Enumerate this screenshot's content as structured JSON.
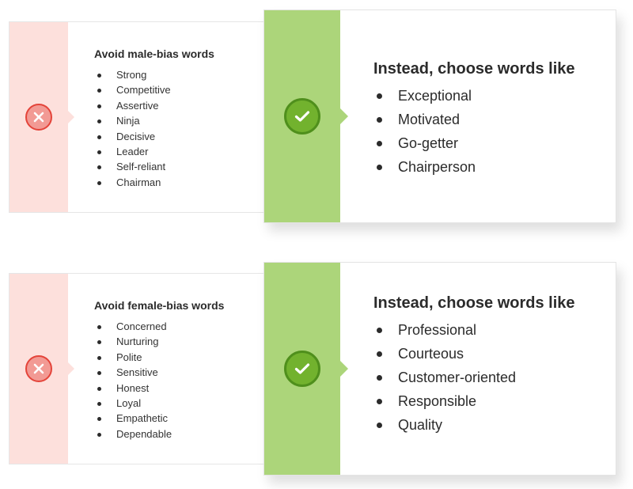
{
  "sections": [
    {
      "avoid": {
        "icon": "x-circle-icon",
        "title": "Avoid male-bias words",
        "items": [
          "Strong",
          "Competitive",
          "Assertive",
          "Ninja",
          "Decisive",
          "Leader",
          "Self-reliant",
          "Chairman"
        ]
      },
      "choose": {
        "icon": "check-circle-icon",
        "title": "Instead, choose words like",
        "items": [
          "Exceptional",
          "Motivated",
          "Go-getter",
          "Chairperson"
        ]
      }
    },
    {
      "avoid": {
        "icon": "x-circle-icon",
        "title": "Avoid female-bias words",
        "items": [
          "Concerned",
          "Nurturing",
          "Polite",
          "Sensitive",
          "Honest",
          "Loyal",
          "Empathetic",
          "Dependable"
        ]
      },
      "choose": {
        "icon": "check-circle-icon",
        "title": "Instead, choose words like",
        "items": [
          "Professional",
          "Courteous",
          "Customer-oriented",
          "Responsible",
          "Quality"
        ]
      }
    }
  ],
  "colors": {
    "avoid_strip": "#fde0dc",
    "avoid_icon_fill": "#f29a94",
    "avoid_icon_border": "#e4443a",
    "choose_strip": "#acd57a",
    "choose_icon_fill": "#72b22e",
    "choose_icon_border": "#4f8f1c",
    "text": "#2b2b2b"
  }
}
